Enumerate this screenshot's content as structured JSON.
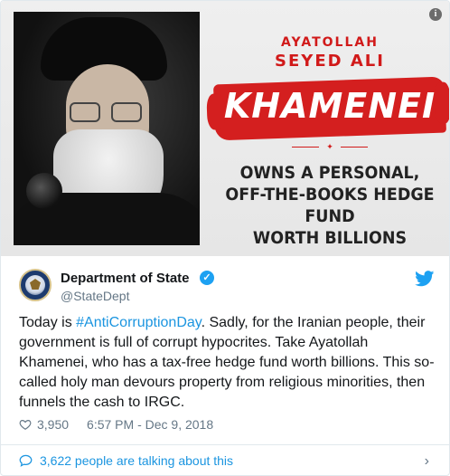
{
  "media": {
    "banner_line1": "AYATOLLAH",
    "banner_line2": "SEYED ALI",
    "banner_name": "KHAMENEI",
    "banner_caption": "OWNS A PERSONAL, OFF-THE-BOOKS HEDGE FUND WORTH BILLIONS",
    "info_icon": "info-icon"
  },
  "account": {
    "name": "Department of State",
    "handle": "@StateDept",
    "verified_icon": "verified-badge-icon",
    "avatar_icon": "state-department-seal"
  },
  "tweet": {
    "text_before": "Today is ",
    "hashtag": "#AntiCorruptionDay",
    "text_after": ". Sadly, for the Iranian people, their government is full of corrupt hypocrites. Take Ayatollah Khamenei, who has a tax-free hedge fund worth billions. This so-called holy man devours property from religious minorities, then funnels the cash to IRGC."
  },
  "meta": {
    "likes": "3,950",
    "timestamp": "6:57 PM - Dec 9, 2018"
  },
  "footer": {
    "talking": "3,622 people are talking about this"
  },
  "colors": {
    "accent": "#1da1f2",
    "link": "#1b95e0",
    "banner_red": "#d41f1f",
    "muted": "#657786"
  }
}
